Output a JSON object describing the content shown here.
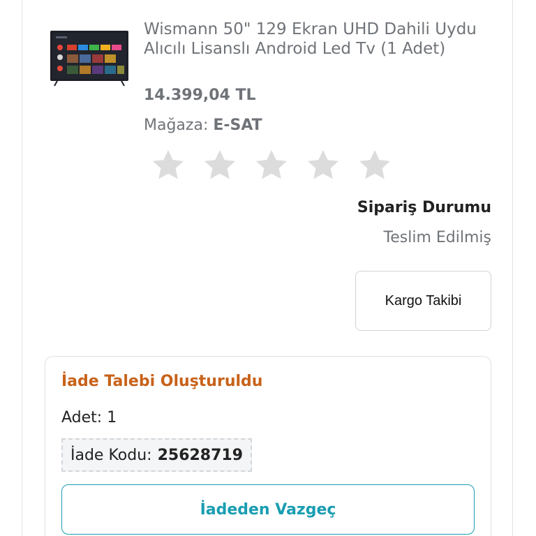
{
  "product": {
    "title": "Wismann 50\" 129 Ekran UHD Dahili Uydu Alıcılı Lisanslı Android Led Tv (1 Adet)",
    "price": "14.399,04 TL",
    "store_label": "Mağaza:",
    "store_name": "E-SAT",
    "image_icon": "tv-product-image"
  },
  "rating": {
    "max": 5,
    "value": 0,
    "star_color": "#dcdcdc"
  },
  "order_status": {
    "title": "Sipariş Durumu",
    "value": "Teslim Edilmiş",
    "tracking_button": "Kargo Takibi"
  },
  "return_request": {
    "title": "İade Talebi Oluşturuldu",
    "quantity_text": "Adet: 1",
    "code_label": "İade Kodu:",
    "code_value": "25628719",
    "cancel_button": "İadeden Vazgeç",
    "title_color": "#c8621a",
    "accent_color": "#1a9db1"
  }
}
